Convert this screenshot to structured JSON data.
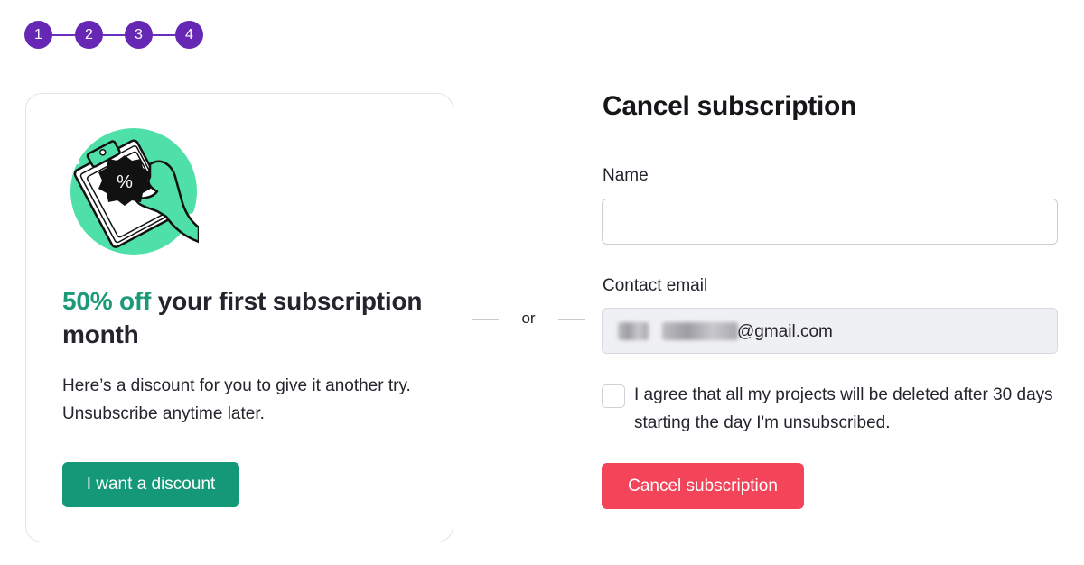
{
  "stepper": {
    "steps": [
      "1",
      "2",
      "3",
      "4"
    ]
  },
  "offer": {
    "title_highlight": "50% off",
    "title_rest": " your first subscription month",
    "description": "Here’s a discount for you to give it another try. Unsubscribe anytime later.",
    "button_label": "I want a discount",
    "illustration_icon": "discount-clipboard-icon",
    "badge_text": "%"
  },
  "divider": {
    "label": "or"
  },
  "cancel_form": {
    "title": "Cancel subscription",
    "name_label": "Name",
    "name_value": "",
    "email_label": "Contact email",
    "email_domain": "@gmail.com",
    "agree_text": "I agree that all my projects will be deleted after 30 days starting the day I'm unsubscribed.",
    "agree_checked": false,
    "button_label": "Cancel subscription"
  },
  "colors": {
    "step_purple": "#6628b4",
    "accent_green": "#159877",
    "highlight_green": "#1c9a78",
    "danger_red": "#f44459",
    "illustration_green": "#4ee0a8"
  }
}
